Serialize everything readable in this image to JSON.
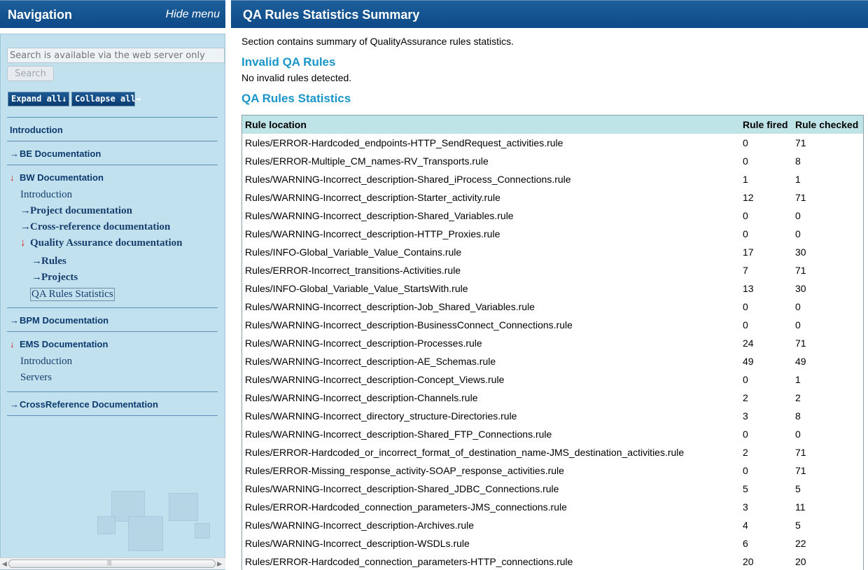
{
  "nav": {
    "title": "Navigation",
    "hide_menu": "Hide menu",
    "search_placeholder": "Search is available via the web server only",
    "search_button": "Search",
    "expand_all": "Expand all↓",
    "collapse_all": "Collapse all→",
    "introduction": "Introduction",
    "be_doc": "BE Documentation",
    "bw_doc": "BW Documentation",
    "bw_intro": "Introduction",
    "project_doc": "Project documentation",
    "crossref_doc": "Cross-reference documentation",
    "qa_doc": "Quality Assurance documentation",
    "rules": "Rules",
    "projects": "Projects",
    "qa_stats": "QA Rules Statistics",
    "bpm_doc": "BPM Documentation",
    "ems_doc": "EMS Documentation",
    "ems_intro": "Introduction",
    "servers": "Servers",
    "crossreference_doc": "CrossReference Documentation",
    "arrow_right": "→",
    "arrow_down": "↓"
  },
  "main": {
    "title": "QA Rules Statistics Summary",
    "description": "Section contains summary of QualityAssurance rules statistics.",
    "invalid_title": "Invalid QA Rules",
    "invalid_text": "No invalid rules detected.",
    "stats_title": "QA Rules Statistics"
  },
  "table": {
    "headers": [
      "Rule location",
      "Rule fired",
      "Rule checked"
    ],
    "rows": [
      [
        "Rules/ERROR-Hardcoded_endpoints-HTTP_SendRequest_activities.rule",
        "0",
        "71"
      ],
      [
        "Rules/ERROR-Multiple_CM_names-RV_Transports.rule",
        "0",
        "8"
      ],
      [
        "Rules/WARNING-Incorrect_description-Shared_iProcess_Connections.rule",
        "1",
        "1"
      ],
      [
        "Rules/WARNING-Incorrect_description-Starter_activity.rule",
        "12",
        "71"
      ],
      [
        "Rules/WARNING-Incorrect_description-Shared_Variables.rule",
        "0",
        "0"
      ],
      [
        "Rules/WARNING-Incorrect_description-HTTP_Proxies.rule",
        "0",
        "0"
      ],
      [
        "Rules/INFO-Global_Variable_Value_Contains.rule",
        "17",
        "30"
      ],
      [
        "Rules/ERROR-Incorrect_transitions-Activities.rule",
        "7",
        "71"
      ],
      [
        "Rules/INFO-Global_Variable_Value_StartsWith.rule",
        "13",
        "30"
      ],
      [
        "Rules/WARNING-Incorrect_description-Job_Shared_Variables.rule",
        "0",
        "0"
      ],
      [
        "Rules/WARNING-Incorrect_description-BusinessConnect_Connections.rule",
        "0",
        "0"
      ],
      [
        "Rules/WARNING-Incorrect_description-Processes.rule",
        "24",
        "71"
      ],
      [
        "Rules/WARNING-Incorrect_description-AE_Schemas.rule",
        "49",
        "49"
      ],
      [
        "Rules/WARNING-Incorrect_description-Concept_Views.rule",
        "0",
        "1"
      ],
      [
        "Rules/WARNING-Incorrect_description-Channels.rule",
        "2",
        "2"
      ],
      [
        "Rules/WARNING-Incorrect_directory_structure-Directories.rule",
        "3",
        "8"
      ],
      [
        "Rules/WARNING-Incorrect_description-Shared_FTP_Connections.rule",
        "0",
        "0"
      ],
      [
        "Rules/ERROR-Hardcoded_or_incorrect_format_of_destination_name-JMS_destination_activities.rule",
        "2",
        "71"
      ],
      [
        "Rules/ERROR-Missing_response_activity-SOAP_response_activities.rule",
        "0",
        "71"
      ],
      [
        "Rules/WARNING-Incorrect_description-Shared_JDBC_Connections.rule",
        "5",
        "5"
      ],
      [
        "Rules/ERROR-Hardcoded_connection_parameters-JMS_connections.rule",
        "3",
        "11"
      ],
      [
        "Rules/WARNING-Incorrect_description-Archives.rule",
        "4",
        "5"
      ],
      [
        "Rules/WARNING-Incorrect_description-WSDLs.rule",
        "6",
        "22"
      ],
      [
        "Rules/ERROR-Hardcoded_connection_parameters-HTTP_connections.rule",
        "20",
        "20"
      ]
    ]
  },
  "colors": {
    "header_bg": "#0d4a86",
    "nav_bg": "#c2e1ef",
    "section_title": "#1a95c8",
    "table_header_bg": "#bfe4e8",
    "expanded_arrow": "#d61a1a"
  }
}
